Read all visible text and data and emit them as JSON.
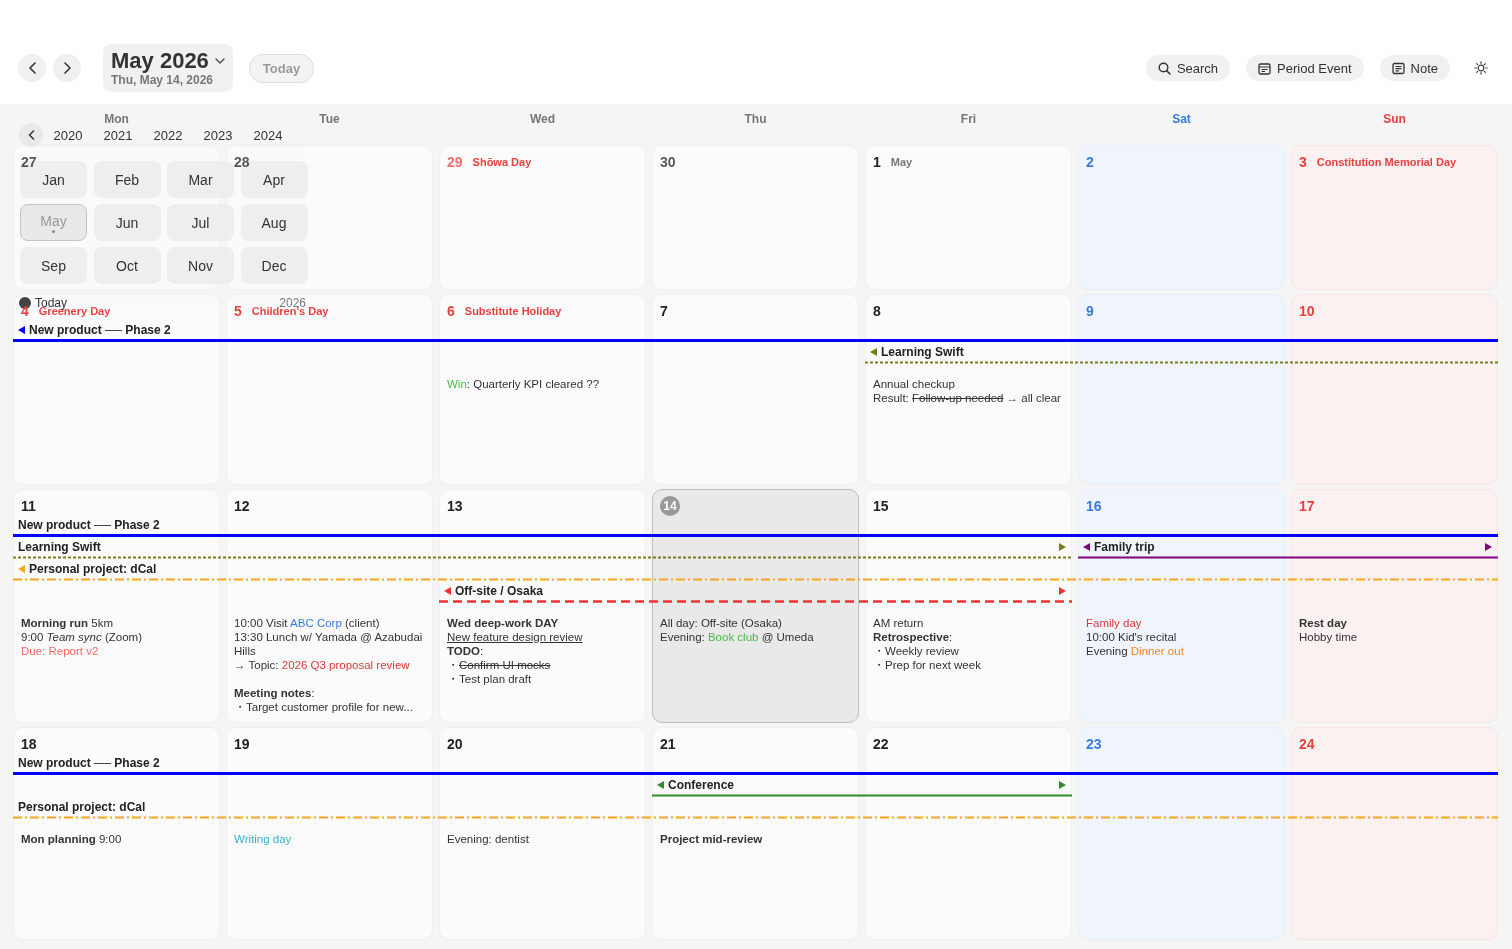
{
  "toolbar": {
    "title": "May 2026",
    "subtitle": "Thu, May 14, 2026",
    "today_button": "Today",
    "actions": [
      {
        "label": "Search",
        "kind": "search"
      },
      {
        "label": "Period Event",
        "kind": "period"
      },
      {
        "label": "Note",
        "kind": "note"
      }
    ]
  },
  "weekdays": [
    {
      "label": "Mon",
      "kind": "weekday"
    },
    {
      "label": "Tue",
      "kind": "weekday"
    },
    {
      "label": "Wed",
      "kind": "weekday"
    },
    {
      "label": "Thu",
      "kind": "weekday"
    },
    {
      "label": "Fri",
      "kind": "weekday"
    },
    {
      "label": "Sat",
      "kind": "saturday"
    },
    {
      "label": "Sun",
      "kind": "sunday"
    }
  ],
  "weeks": [
    {
      "days": [
        {
          "day": "27",
          "other_month": true,
          "today": false
        },
        {
          "day": "28",
          "other_month": true,
          "today": false
        },
        {
          "day": "29",
          "other_month": true,
          "today": false,
          "label": {
            "text": "Shōwa Day",
            "kind": "holiday"
          }
        },
        {
          "day": "30",
          "other_month": true,
          "today": false
        },
        {
          "day": "1",
          "other_month": false,
          "today": false,
          "label": {
            "text": "May",
            "kind": "month"
          }
        },
        {
          "day": "2",
          "other_month": false,
          "today": false
        },
        {
          "day": "3",
          "other_month": false,
          "today": false,
          "label": {
            "text": "Constitution Memorial Day",
            "kind": "holiday"
          }
        }
      ]
    },
    {
      "days": [
        {
          "day": "4",
          "other_month": false,
          "today": false,
          "label": {
            "text": "Greenery Day",
            "kind": "holiday"
          }
        },
        {
          "day": "5",
          "other_month": false,
          "today": false,
          "label": {
            "text": "Children's Day",
            "kind": "holiday"
          }
        },
        {
          "day": "6",
          "other_month": false,
          "today": false,
          "label": {
            "text": "Substitute Holiday",
            "kind": "holiday"
          },
          "notes": [
            {
              "parts": [
                {
                  "text": "Win",
                  "kind": "green"
                },
                {
                  "text": ": Quarterly KPI cleared ??"
                }
              ]
            }
          ]
        },
        {
          "day": "7",
          "other_month": false,
          "today": false
        },
        {
          "day": "8",
          "other_month": false,
          "today": false,
          "notes": [
            {
              "parts": [
                {
                  "text": "Annual checkup"
                }
              ]
            },
            {
              "parts": [
                {
                  "text": "Result: "
                },
                {
                  "text": "Follow-up needed",
                  "kind": "strike"
                },
                {
                  "text": " → all clear"
                }
              ]
            }
          ]
        },
        {
          "day": "9",
          "other_month": false,
          "today": false
        },
        {
          "day": "10",
          "other_month": false,
          "today": false
        }
      ],
      "lanes": [
        [
          {
            "kind": "thick",
            "title": "New product ── Phase 2",
            "color": "#0000ff",
            "arrow_start": true,
            "arrow_end": false
          },
          {
            "kind": "continued"
          },
          {
            "kind": "continued"
          },
          {
            "kind": "continued"
          },
          {
            "kind": "continued"
          },
          {
            "kind": "continued"
          },
          {
            "kind": "continued"
          }
        ],
        [
          {
            "kind": "empty"
          },
          {
            "kind": "empty"
          },
          {
            "kind": "empty"
          },
          {
            "kind": "empty"
          },
          {
            "kind": "dotted",
            "title": "Learning Swift",
            "color": "#7d7d1e",
            "arrow_start": true,
            "arrow_end": false
          },
          {
            "kind": "continued"
          },
          {
            "kind": "continued"
          }
        ]
      ]
    },
    {
      "days": [
        {
          "day": "11",
          "other_month": false,
          "today": false,
          "notes": [
            {
              "parts": [
                {
                  "text": "Morning run",
                  "kind": "bold"
                },
                {
                  "text": " 5km"
                }
              ]
            },
            {
              "parts": [
                {
                  "text": "9:00 "
                },
                {
                  "text": "Team sync",
                  "kind": "italic"
                },
                {
                  "text": " (Zoom)"
                }
              ]
            },
            {
              "parts": [
                {
                  "text": "Due: Report v2",
                  "kind": "pink"
                }
              ]
            }
          ]
        },
        {
          "day": "12",
          "other_month": false,
          "today": false,
          "notes": [
            {
              "parts": [
                {
                  "text": "10:00 Visit "
                },
                {
                  "text": "ABC Corp",
                  "kind": "blue"
                },
                {
                  "text": " (client)"
                }
              ]
            },
            {
              "parts": [
                {
                  "text": "13:30 Lunch w/ Yamada @ Azabudai Hills"
                }
              ]
            },
            {
              "parts": [
                {
                  "text": "→ Topic: "
                },
                {
                  "text": "2026 Q3 proposal review",
                  "kind": "red"
                }
              ]
            },
            {
              "kind": "blank"
            },
            {
              "parts": [
                {
                  "text": "Meeting notes",
                  "kind": "bold"
                },
                {
                  "text": ":"
                }
              ]
            },
            {
              "parts": [
                {
                  "text": "・Target customer profile for new..."
                }
              ]
            }
          ]
        },
        {
          "day": "13",
          "other_month": false,
          "today": false,
          "notes": [
            {
              "parts": [
                {
                  "text": "Wed deep-work DAY",
                  "kind": "bold"
                }
              ]
            },
            {
              "parts": [
                {
                  "text": "New feature design review",
                  "kind": "underline"
                }
              ]
            },
            {
              "parts": [
                {
                  "text": "TODO",
                  "kind": "bold"
                },
                {
                  "text": ":"
                }
              ]
            },
            {
              "parts": [
                {
                  "text": "・"
                },
                {
                  "text": "Confirm UI mocks",
                  "kind": "strike"
                }
              ]
            },
            {
              "parts": [
                {
                  "text": "・Test plan draft"
                }
              ]
            }
          ]
        },
        {
          "day": "14",
          "other_month": false,
          "today": true,
          "notes": [
            {
              "parts": [
                {
                  "text": "All day: Off-site (Osaka)"
                }
              ]
            },
            {
              "parts": [
                {
                  "text": "Evening: "
                },
                {
                  "text": "Book club",
                  "kind": "green"
                },
                {
                  "text": " @ Umeda"
                }
              ]
            }
          ]
        },
        {
          "day": "15",
          "other_month": false,
          "today": false,
          "notes": [
            {
              "parts": [
                {
                  "text": "AM return"
                }
              ]
            },
            {
              "parts": [
                {
                  "text": "Retrospective",
                  "kind": "bold"
                },
                {
                  "text": ":"
                }
              ]
            },
            {
              "parts": [
                {
                  "text": "・Weekly review"
                }
              ]
            },
            {
              "parts": [
                {
                  "text": "・Prep for next week"
                }
              ]
            }
          ]
        },
        {
          "day": "16",
          "other_month": false,
          "today": false,
          "notes": [
            {
              "parts": [
                {
                  "text": "Family day",
                  "kind": "red"
                }
              ]
            },
            {
              "parts": [
                {
                  "text": "10:00 Kid's recital"
                }
              ]
            },
            {
              "parts": [
                {
                  "text": "Evening "
                },
                {
                  "text": "Dinner out",
                  "kind": "orange"
                }
              ]
            }
          ]
        },
        {
          "day": "17",
          "other_month": false,
          "today": false,
          "notes": [
            {
              "parts": [
                {
                  "text": "Rest day",
                  "kind": "bold"
                }
              ]
            },
            {
              "parts": [
                {
                  "text": "Hobby time"
                }
              ]
            }
          ]
        }
      ],
      "lanes": [
        [
          {
            "kind": "thick",
            "title": "New product ── Phase 2",
            "color": "#0000ff",
            "arrow_start": false,
            "arrow_end": false
          },
          {
            "kind": "continued"
          },
          {
            "kind": "continued"
          },
          {
            "kind": "continued"
          },
          {
            "kind": "continued"
          },
          {
            "kind": "continued"
          },
          {
            "kind": "continued"
          }
        ],
        [
          {
            "kind": "dotted",
            "title": "Learning Swift",
            "color": "#7d7d1e",
            "arrow_start": false,
            "arrow_end": true
          },
          {
            "kind": "continued"
          },
          {
            "kind": "continued"
          },
          {
            "kind": "continued"
          },
          {
            "kind": "continued"
          },
          {
            "kind": "solid",
            "title": "Family trip",
            "color": "#800080",
            "arrow_start": true,
            "arrow_end": true
          },
          {
            "kind": "continued"
          }
        ],
        [
          {
            "kind": "dashdot",
            "title": "Personal project: dCal",
            "color": "#f5a623",
            "arrow_start": true,
            "arrow_end": false
          },
          {
            "kind": "continued"
          },
          {
            "kind": "continued"
          },
          {
            "kind": "continued"
          },
          {
            "kind": "continued"
          },
          {
            "kind": "continued"
          },
          {
            "kind": "continued"
          }
        ],
        [
          {
            "kind": "empty"
          },
          {
            "kind": "empty"
          },
          {
            "kind": "dashed",
            "title": "Off-site / Osaka",
            "color": "#ee3333",
            "arrow_start": true,
            "arrow_end": true
          },
          {
            "kind": "continued"
          },
          {
            "kind": "continued"
          },
          {
            "kind": "empty"
          },
          {
            "kind": "empty"
          }
        ]
      ]
    },
    {
      "days": [
        {
          "day": "18",
          "other_month": false,
          "today": false,
          "notes": [
            {
              "parts": [
                {
                  "text": "Mon planning",
                  "kind": "bold"
                },
                {
                  "text": " 9:00"
                }
              ]
            }
          ]
        },
        {
          "day": "19",
          "other_month": false,
          "today": false,
          "notes": [
            {
              "parts": [
                {
                  "text": "Writing day",
                  "kind": "cyan"
                }
              ]
            }
          ]
        },
        {
          "day": "20",
          "other_month": false,
          "today": false,
          "notes": [
            {
              "parts": [
                {
                  "text": "Evening: dentist"
                }
              ]
            }
          ]
        },
        {
          "day": "21",
          "other_month": false,
          "today": false,
          "notes": [
            {
              "parts": [
                {
                  "text": "Project mid-review",
                  "kind": "bold"
                }
              ]
            }
          ]
        },
        {
          "day": "22",
          "other_month": false,
          "today": false
        },
        {
          "day": "23",
          "other_month": false,
          "today": false
        },
        {
          "day": "24",
          "other_month": false,
          "today": false
        }
      ],
      "lanes": [
        [
          {
            "kind": "thick",
            "title": "New product ── Phase 2",
            "color": "#0000ff",
            "arrow_start": false,
            "arrow_end": false
          },
          {
            "kind": "continued"
          },
          {
            "kind": "continued"
          },
          {
            "kind": "continued"
          },
          {
            "kind": "continued"
          },
          {
            "kind": "continued"
          },
          {
            "kind": "continued"
          }
        ],
        [
          {
            "kind": "empty"
          },
          {
            "kind": "empty"
          },
          {
            "kind": "empty"
          },
          {
            "kind": "solid",
            "title": "Conference",
            "color": "#2e8b2e",
            "arrow_start": true,
            "arrow_end": true
          },
          {
            "kind": "continued"
          },
          {
            "kind": "empty"
          },
          {
            "kind": "empty"
          }
        ],
        [
          {
            "kind": "dashdot",
            "title": "Personal project: dCal",
            "color": "#f5a623",
            "arrow_start": false,
            "arrow_end": false
          },
          {
            "kind": "continued"
          },
          {
            "kind": "continued"
          },
          {
            "kind": "continued"
          },
          {
            "kind": "continued"
          },
          {
            "kind": "continued"
          },
          {
            "kind": "continued"
          }
        ]
      ]
    }
  ],
  "month_picker": {
    "years": [
      "2020",
      "2021",
      "2022",
      "2023",
      "2024"
    ],
    "months": [
      {
        "label": "Jan",
        "selected": false
      },
      {
        "label": "Feb",
        "selected": false
      },
      {
        "label": "Mar",
        "selected": false
      },
      {
        "label": "Apr",
        "selected": false
      },
      {
        "label": "May",
        "selected": true
      },
      {
        "label": "Jun",
        "selected": false
      },
      {
        "label": "Jul",
        "selected": false
      },
      {
        "label": "Aug",
        "selected": false
      },
      {
        "label": "Sep",
        "selected": false
      },
      {
        "label": "Oct",
        "selected": false
      },
      {
        "label": "Nov",
        "selected": false
      },
      {
        "label": "Dec",
        "selected": false
      }
    ],
    "today_label": "Today",
    "year": "2026"
  }
}
